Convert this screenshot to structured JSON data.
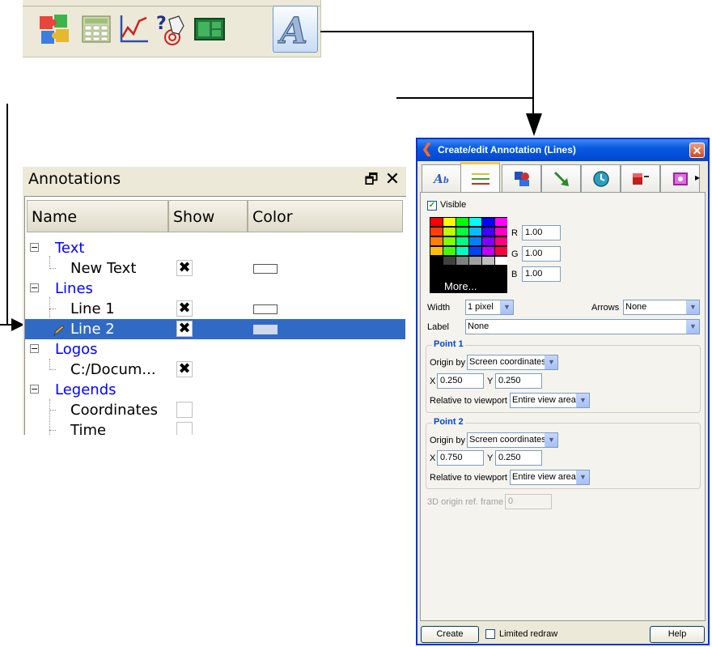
{
  "toolbar": {
    "buttons": [
      {
        "icon": "puzzle-icon"
      },
      {
        "icon": "spreadsheet-icon"
      },
      {
        "icon": "curve-plot-icon"
      },
      {
        "icon": "pick-query-icon"
      },
      {
        "icon": "layout-icon"
      },
      {
        "icon": "annotation-icon",
        "active": true
      }
    ]
  },
  "annotations_panel": {
    "title": "Annotations",
    "columns": [
      "Name",
      "Show",
      "Color"
    ],
    "groups": [
      {
        "label": "Text",
        "expander": "⊟",
        "items": [
          {
            "label": "New Text",
            "show": true,
            "color": "#ffffff"
          }
        ]
      },
      {
        "label": "Lines",
        "expander": "⊟",
        "items": [
          {
            "label": "Line 1",
            "show": true,
            "color": "#ffffff"
          },
          {
            "label": "Line 2",
            "show": true,
            "color": "#d0d8ec",
            "selected": true
          }
        ]
      },
      {
        "label": "Logos",
        "expander": "⊟",
        "items": [
          {
            "label": "C:/Docum...",
            "show": true
          }
        ]
      },
      {
        "label": "Legends",
        "expander": "⊟",
        "items": [
          {
            "label": "Coordinates",
            "show": false
          },
          {
            "label": "Time",
            "show": false
          }
        ]
      }
    ]
  },
  "dialog": {
    "title": "Create/edit Annotation (Lines)",
    "tabs": [
      "text-2d-tab",
      "lines-tab",
      "objects-tab",
      "arrow-tab",
      "time-tab",
      "legend-tab",
      "image-tab"
    ],
    "visible_label": "Visible",
    "more_label": "More...",
    "rgb": [
      {
        "label": "R",
        "value": "1.00"
      },
      {
        "label": "G",
        "value": "1.00"
      },
      {
        "label": "B",
        "value": "1.00"
      }
    ],
    "width_label": "Width",
    "width_value": "1 pixel",
    "arrows_label": "Arrows",
    "arrows_value": "None",
    "label_label": "Label",
    "label_value": "None",
    "point1": {
      "title": "Point 1",
      "origin_label": "Origin by",
      "origin_value": "Screen coordinates",
      "x_label": "X",
      "x_value": "0.250",
      "y_label": "Y",
      "y_value": "0.250",
      "relative_label": "Relative to viewport",
      "relative_value": "Entire view area"
    },
    "point2": {
      "title": "Point 2",
      "origin_label": "Origin by",
      "origin_value": "Screen coordinates",
      "x_label": "X",
      "x_value": "0.750",
      "y_label": "Y",
      "y_value": "0.250",
      "relative_label": "Relative to viewport",
      "relative_value": "Entire view area"
    },
    "origin_ref_label": "3D origin ref. frame",
    "origin_ref_value": "0",
    "create_label": "Create",
    "limited_redraw_label": "Limited redraw",
    "help_label": "Help"
  }
}
